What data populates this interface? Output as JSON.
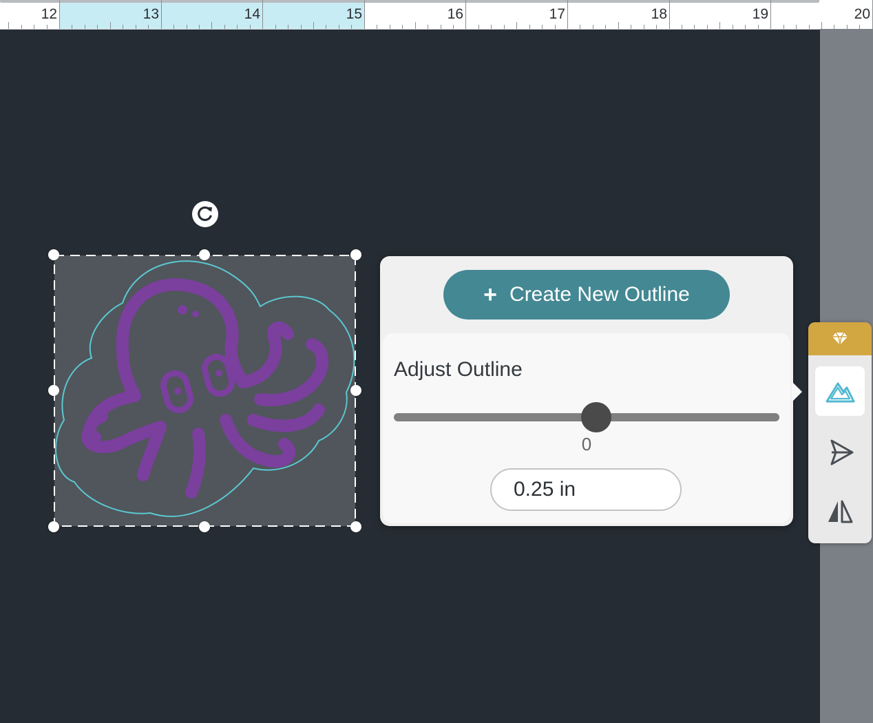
{
  "ruler": {
    "labels": [
      "12",
      "13",
      "14",
      "15",
      "16",
      "17",
      "18",
      "19",
      "20"
    ],
    "highlight_color": "#c8ecf4"
  },
  "design": {
    "name": "octopus",
    "outline_color": "#5bc8d2",
    "stroke_color": "#7b3f9e",
    "fill_color": "#50565b"
  },
  "outline_panel": {
    "create_button_label": "Create New Outline",
    "create_button_icon": "plus-icon",
    "adjust_title": "Adjust Outline",
    "slider": {
      "value": "0",
      "min": -1,
      "max": 1,
      "position": 0
    },
    "outline_size_value": "0.25 in"
  },
  "tool_panel": {
    "header_icon": "diamond-icon",
    "tools": [
      {
        "name": "outline-tool",
        "icon": "mountain-icon",
        "active": true
      },
      {
        "name": "offset-tool",
        "icon": "send-icon",
        "active": false
      },
      {
        "name": "mirror-tool",
        "icon": "mirror-icon",
        "active": false
      }
    ]
  },
  "colors": {
    "accent": "#438893",
    "premium": "#d2a640",
    "canvas": "#252c33"
  }
}
